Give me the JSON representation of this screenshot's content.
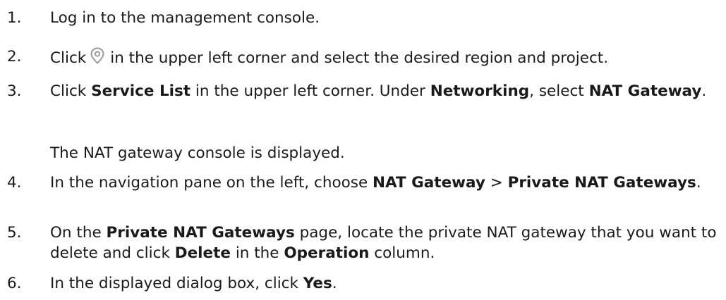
{
  "steps": [
    {
      "number": "1.",
      "parts": [
        "Log in to the management console."
      ]
    },
    {
      "number": "2.",
      "before_icon": "Click",
      "icon": "location-pin-icon",
      "after_icon": "in the upper left corner and select the desired region and project."
    },
    {
      "number": "3.",
      "t1": "Click ",
      "b1": "Service List",
      "t2": " in the upper left corner. Under ",
      "b2": "Networking",
      "t3": ", select ",
      "b3": "NAT Gateway",
      "t4": ".",
      "note": "The NAT gateway console is displayed."
    },
    {
      "number": "4.",
      "t1": "In the navigation pane on the left, choose ",
      "b1": "NAT Gateway",
      "t2": " > ",
      "b2": "Private NAT Gateways",
      "t3": "."
    },
    {
      "number": "5.",
      "t1": "On the ",
      "b1": "Private NAT Gateways",
      "t2": " page, locate the private NAT gateway that you want to delete and click ",
      "b2": "Delete",
      "t3": " in the ",
      "b3": "Operation",
      "t4": " column."
    },
    {
      "number": "6.",
      "t1": "In the displayed dialog box, click ",
      "b1": "Yes",
      "t2": "."
    }
  ],
  "colors": {
    "text": "#1a1a1a",
    "icon": "#9a9a9a"
  }
}
